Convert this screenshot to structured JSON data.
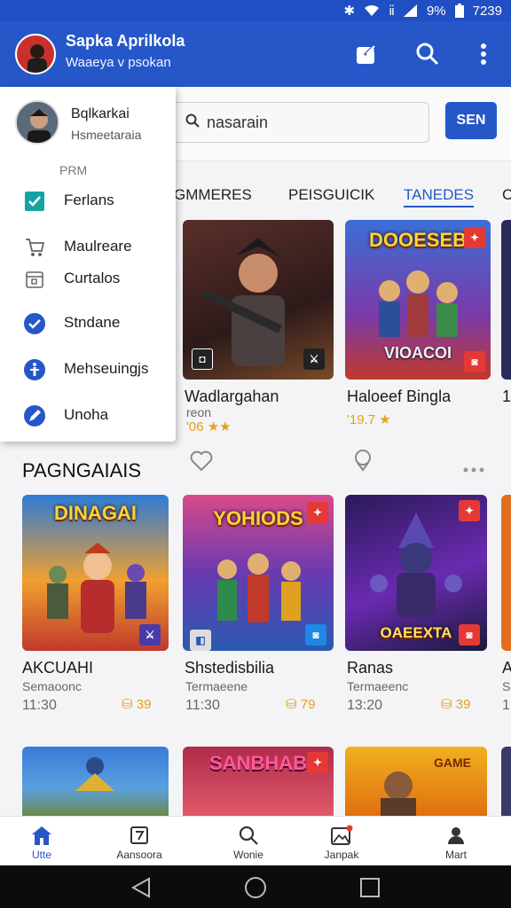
{
  "status_bar": {
    "battery": "9%",
    "time": "7239"
  },
  "app_bar": {
    "title": "Sapka Aprilkola",
    "subtitle": "Waaeya v psokan"
  },
  "search": {
    "value": "nasarain",
    "button_label": "SEN"
  },
  "tabs": [
    "GMMERES",
    "PEISGUICIK",
    "TANEDES",
    "C"
  ],
  "active_tab": "TANEDES",
  "top_cards": [
    {
      "title": "Wadlargahan",
      "sub": "reon",
      "rating": "'06 ★★"
    },
    {
      "title": "Haloeef Bingla",
      "sub": "",
      "rating": "'19.7 ★"
    },
    {
      "title": "1",
      "sub": "",
      "rating": ""
    }
  ],
  "section_title": "PAGNGAIAIS",
  "section_cards": [
    {
      "art": "DINAGAI",
      "title": "AKCUAHI",
      "sub": "Semaoonc",
      "time": "11:30",
      "price": "39"
    },
    {
      "art": "YOHIODS",
      "title": "Shstedisbilia",
      "sub": "Termaeene",
      "time": "11:30",
      "price": "79"
    },
    {
      "art": "OAEEXTA",
      "title": "Ranas",
      "sub": "Termaeenc",
      "time": "13:20",
      "price": "39"
    },
    {
      "art": "",
      "title": "A",
      "sub": "S",
      "time": "1",
      "price": ""
    }
  ],
  "bottom_row_art": [
    "",
    "SANBHAB",
    "GAME"
  ],
  "top_card_art": [
    "",
    "DOOESEB",
    "VIOACOI"
  ],
  "drawer": {
    "name": "Bqlkarkai",
    "sub": "Hsmeetaraia",
    "section": "PRM",
    "items": [
      {
        "label": "Ferlans",
        "icon": "checkbox-icon"
      },
      {
        "label": "Maulreare",
        "icon": "cart-icon"
      },
      {
        "label": "Curtalos",
        "icon": "calendar-icon"
      },
      {
        "label": "Stndane",
        "icon": "check-circle-icon"
      },
      {
        "label": "Mehseuingjs",
        "icon": "info-circle-icon"
      },
      {
        "label": "Unoha",
        "icon": "pen-icon"
      }
    ]
  },
  "bottom_nav": [
    {
      "label": "Utte",
      "icon": "home-icon"
    },
    {
      "label": "Aansoora",
      "icon": "news-icon"
    },
    {
      "label": "Wonie",
      "icon": "search-icon"
    },
    {
      "label": "Janpak",
      "icon": "image-icon"
    },
    {
      "label": "Mart",
      "icon": "person-icon"
    }
  ],
  "colors": {
    "primary": "#2557c9",
    "accent": "#e6a01a"
  }
}
